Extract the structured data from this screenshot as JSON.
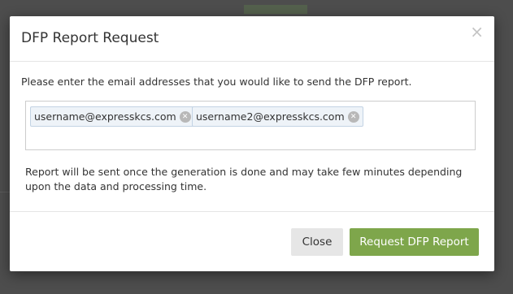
{
  "modal": {
    "title": "DFP Report Request",
    "close_symbol": "×",
    "instruction": "Please enter the email addresses that you would like to send the DFP report.",
    "emails": [
      "username@expresskcs.com",
      "username2@expresskcs.com"
    ],
    "remove_symbol": "✕",
    "note": "Report will be sent once the generation is done and may take few minutes depending upon the data and processing time.",
    "buttons": {
      "close_label": "Close",
      "request_label": "Request DFP Report"
    }
  },
  "colors": {
    "primary_button": "#7ea64b",
    "secondary_button": "#e6e6e6",
    "tag_background": "#eef3f8",
    "tag_border": "#c3d3e4",
    "overlay": "#4d4d4d"
  },
  "icons": {
    "close": "close-icon",
    "tag_remove": "remove-tag-icon"
  }
}
